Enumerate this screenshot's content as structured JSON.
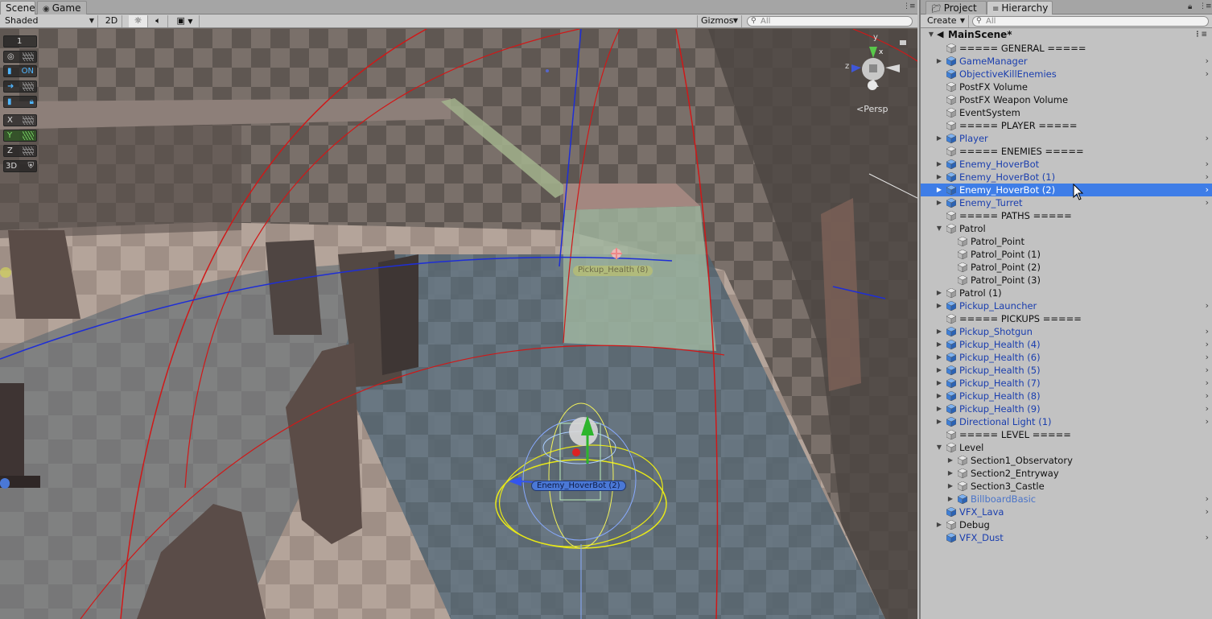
{
  "scene_panel": {
    "tabs": [
      {
        "label": "Scene",
        "active": true
      },
      {
        "label": "Game",
        "active": false
      }
    ],
    "toolbar": {
      "shading_mode": "Shaded",
      "mode_2d": "2D",
      "gizmos_label": "Gizmos",
      "search_placeholder": "All"
    },
    "overlay": {
      "layer_value": "1",
      "toggle_on": "ON",
      "axis_x": "X",
      "axis_y": "Y",
      "axis_z": "Z",
      "mode_3d": "3D"
    },
    "gizmo": {
      "axis_y": "y",
      "axis_z": "z",
      "axis_x": "x",
      "projection": "Persp"
    },
    "world_labels": {
      "pickup": "Pickup_Health (8)",
      "enemy": "Enemy_HoverBot (2)"
    }
  },
  "hierarchy_panel": {
    "tabs": [
      {
        "label": "Project",
        "active": false
      },
      {
        "label": "Hierarchy",
        "active": true
      }
    ],
    "create_label": "Create",
    "search_placeholder": "All",
    "scene_name": "MainScene*",
    "items": [
      {
        "label": "===== GENERAL =====",
        "depth": 0,
        "fold": "",
        "kind": "plain"
      },
      {
        "label": "GameManager",
        "depth": 0,
        "fold": "closed",
        "kind": "prefab",
        "chevron": true
      },
      {
        "label": "ObjectiveKillEnemies",
        "depth": 0,
        "fold": "",
        "kind": "prefab",
        "chevron": true
      },
      {
        "label": "PostFX Volume",
        "depth": 0,
        "fold": "",
        "kind": "plain"
      },
      {
        "label": "PostFX Weapon Volume",
        "depth": 0,
        "fold": "",
        "kind": "plain"
      },
      {
        "label": "EventSystem",
        "depth": 0,
        "fold": "",
        "kind": "plain"
      },
      {
        "label": "===== PLAYER =====",
        "depth": 0,
        "fold": "",
        "kind": "plain"
      },
      {
        "label": "Player",
        "depth": 0,
        "fold": "closed",
        "kind": "prefab",
        "chevron": true
      },
      {
        "label": "===== ENEMIES =====",
        "depth": 0,
        "fold": "",
        "kind": "plain"
      },
      {
        "label": "Enemy_HoverBot",
        "depth": 0,
        "fold": "closed",
        "kind": "prefab",
        "chevron": true
      },
      {
        "label": "Enemy_HoverBot (1)",
        "depth": 0,
        "fold": "closed",
        "kind": "prefab",
        "chevron": true
      },
      {
        "label": "Enemy_HoverBot (2)",
        "depth": 0,
        "fold": "closed",
        "kind": "prefab",
        "chevron": true,
        "selected": true
      },
      {
        "label": "Enemy_Turret",
        "depth": 0,
        "fold": "closed",
        "kind": "prefab",
        "chevron": true
      },
      {
        "label": "===== PATHS =====",
        "depth": 0,
        "fold": "",
        "kind": "plain"
      },
      {
        "label": "Patrol",
        "depth": 0,
        "fold": "open",
        "kind": "plain"
      },
      {
        "label": "Patrol_Point",
        "depth": 1,
        "fold": "",
        "kind": "plain"
      },
      {
        "label": "Patrol_Point (1)",
        "depth": 1,
        "fold": "",
        "kind": "plain"
      },
      {
        "label": "Patrol_Point (2)",
        "depth": 1,
        "fold": "",
        "kind": "plain"
      },
      {
        "label": "Patrol_Point (3)",
        "depth": 1,
        "fold": "",
        "kind": "plain"
      },
      {
        "label": "Patrol (1)",
        "depth": 0,
        "fold": "closed",
        "kind": "plain"
      },
      {
        "label": "Pickup_Launcher",
        "depth": 0,
        "fold": "closed",
        "kind": "prefab",
        "chevron": true
      },
      {
        "label": "===== PICKUPS =====",
        "depth": 0,
        "fold": "",
        "kind": "plain"
      },
      {
        "label": "Pickup_Shotgun",
        "depth": 0,
        "fold": "closed",
        "kind": "prefab",
        "chevron": true
      },
      {
        "label": "Pickup_Health (4)",
        "depth": 0,
        "fold": "closed",
        "kind": "prefab",
        "chevron": true
      },
      {
        "label": "Pickup_Health (6)",
        "depth": 0,
        "fold": "closed",
        "kind": "prefab",
        "chevron": true
      },
      {
        "label": "Pickup_Health (5)",
        "depth": 0,
        "fold": "closed",
        "kind": "prefab",
        "chevron": true
      },
      {
        "label": "Pickup_Health (7)",
        "depth": 0,
        "fold": "closed",
        "kind": "prefab",
        "chevron": true
      },
      {
        "label": "Pickup_Health (8)",
        "depth": 0,
        "fold": "closed",
        "kind": "prefab",
        "chevron": true
      },
      {
        "label": "Pickup_Health (9)",
        "depth": 0,
        "fold": "closed",
        "kind": "prefab",
        "chevron": true
      },
      {
        "label": "Directional Light (1)",
        "depth": 0,
        "fold": "closed",
        "kind": "prefab",
        "chevron": true
      },
      {
        "label": "===== LEVEL =====",
        "depth": 0,
        "fold": "",
        "kind": "plain"
      },
      {
        "label": "Level",
        "depth": 0,
        "fold": "open",
        "kind": "plain"
      },
      {
        "label": "Section1_Observatory",
        "depth": 1,
        "fold": "closed",
        "kind": "plain"
      },
      {
        "label": "Section2_Entryway",
        "depth": 1,
        "fold": "closed",
        "kind": "plain"
      },
      {
        "label": "Section3_Castle",
        "depth": 1,
        "fold": "closed",
        "kind": "plain"
      },
      {
        "label": "BillboardBasic",
        "depth": 1,
        "fold": "closed",
        "kind": "prefab-missing",
        "chevron": true
      },
      {
        "label": "VFX_Lava",
        "depth": 0,
        "fold": "",
        "kind": "prefab",
        "chevron": true
      },
      {
        "label": "Debug",
        "depth": 0,
        "fold": "closed",
        "kind": "plain"
      },
      {
        "label": "VFX_Dust",
        "depth": 0,
        "fold": "",
        "kind": "prefab",
        "chevron": true
      }
    ]
  },
  "colors": {
    "selection": "#3e7de7",
    "prefab_text": "#1a3eae",
    "panel_bg": "#c2c2c2"
  }
}
